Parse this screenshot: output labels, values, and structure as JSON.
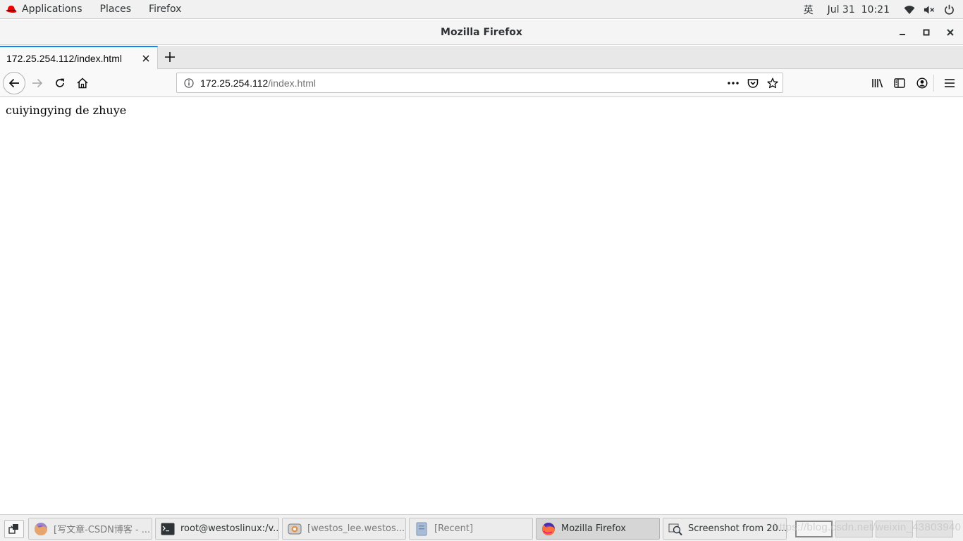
{
  "topbar": {
    "applications": "Applications",
    "places": "Places",
    "app_menu": "Firefox",
    "input_method": "英",
    "date": "Jul 31",
    "time": "10:21",
    "icons": [
      "redhat-icon",
      "wifi-icon",
      "volume-muted-icon",
      "power-icon"
    ]
  },
  "window": {
    "title": "Mozilla Firefox"
  },
  "tabs": [
    {
      "title": "172.25.254.112/index.html",
      "active": true
    }
  ],
  "urlbar": {
    "host": "172.25.254.112",
    "path": "/index.html"
  },
  "content": {
    "text": "cuiyingying de zhuye"
  },
  "taskbar": {
    "tasks": [
      {
        "label": "[写文章-CSDN博客 - ...",
        "icon": "firefox-icon",
        "active": false,
        "dim": true
      },
      {
        "label": "root@westoslinux:/v...",
        "icon": "terminal-icon",
        "active": false,
        "dim": false
      },
      {
        "label": "[westos_lee.westos....",
        "icon": "virt-manager-icon",
        "active": false,
        "dim": true
      },
      {
        "label": "[Recent]",
        "icon": "files-icon",
        "active": false,
        "dim": true
      },
      {
        "label": "Mozilla Firefox",
        "icon": "firefox-icon",
        "active": true,
        "dim": false
      },
      {
        "label": "Screenshot from 20...",
        "icon": "screenshot-icon",
        "active": false,
        "dim": false
      }
    ],
    "workspaces": 4,
    "watermark": "https://blog.csdn.net/weixin_43803940"
  },
  "colors": {
    "accent": "#0a84ff",
    "redhat": "#ee0000",
    "firefox_orange": "#ff7139"
  }
}
